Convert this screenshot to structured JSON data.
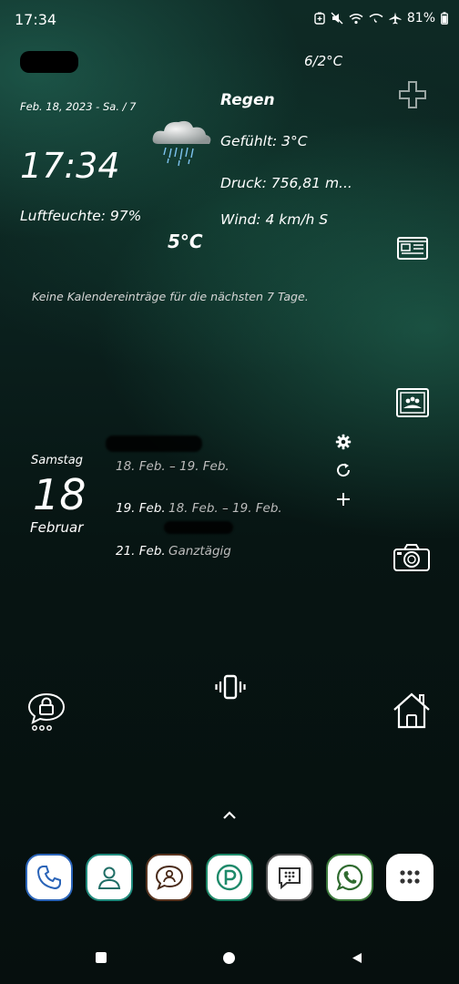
{
  "status_bar": {
    "time": "17:34",
    "battery": "81%",
    "icons": [
      "battery-saver-icon",
      "mute-icon",
      "wifi-icon",
      "wifi-calling-icon",
      "airplane-icon",
      "battery-icon"
    ]
  },
  "weather": {
    "temp_range": "6/2°C",
    "date": "Feb. 18, 2023 - Sa. / 7",
    "clock": "17:34",
    "humidity": "Luftfeuchte: 97%",
    "condition": "Regen",
    "feels_like": "Gefühlt: 3°C",
    "pressure": "Druck: 756,81 m...",
    "wind": "Wind: 4 km/h S",
    "current_temp": "5°C",
    "icon": "rain-cloud-icon"
  },
  "calendar_notice": "Keine Kalendereinträge für die nächsten 7 Tage.",
  "calendar": {
    "day_name": "Samstag",
    "day_number": "18",
    "month": "Februar",
    "events": [
      {
        "date": "",
        "range": "18. Feb. – 19. Feb."
      },
      {
        "date": "19. Feb.",
        "range": "18. Feb. – 19. Feb."
      },
      {
        "date": "21. Feb.",
        "range": "Ganztägig"
      }
    ]
  },
  "side_shortcuts": [
    "add-icon",
    "news-icon",
    "slideshow-icon",
    "camera-icon"
  ],
  "home_shortcuts": [
    "lock-chat-icon",
    "vibrate-icon",
    "home-icon"
  ],
  "dock": [
    "phone-icon",
    "contacts-icon",
    "messaging-icon",
    "parking-icon",
    "bbm-icon",
    "whatsapp-icon",
    "app-drawer-icon"
  ],
  "colors": {
    "accent": "#1f6f5c",
    "dock_bg": "#ffffff"
  }
}
